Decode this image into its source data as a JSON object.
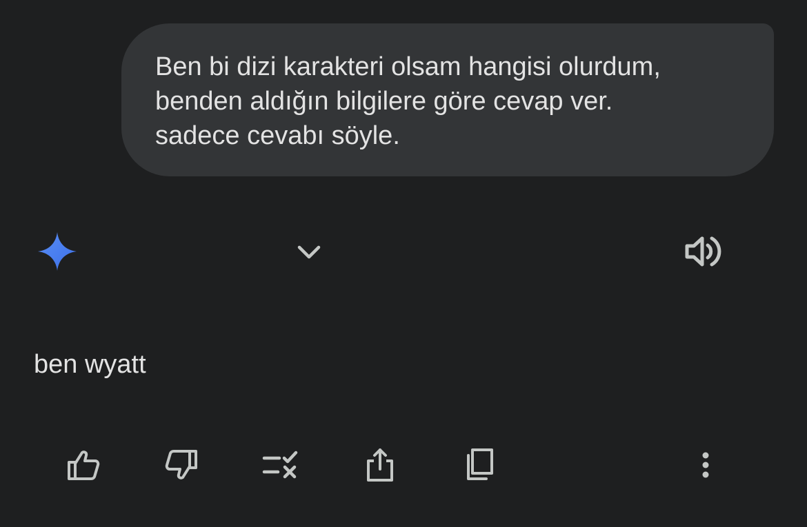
{
  "conversation": {
    "user_message": {
      "lines": [
        "Ben bi dizi karakteri olsam hangisi olurdum,",
        "benden aldığın bilgilere göre cevap ver.",
        "sadece cevabı söyle."
      ]
    },
    "response": {
      "header": {
        "logo_icon": "gemini-sparkle-icon",
        "toggle_icon": "chevron-down-icon",
        "read_aloud_icon": "speaker-icon"
      },
      "text": "ben wyatt"
    },
    "actions": [
      {
        "name": "thumbs-up-icon"
      },
      {
        "name": "thumbs-down-icon"
      },
      {
        "name": "modify-response-icon"
      },
      {
        "name": "share-icon"
      },
      {
        "name": "copy-icon"
      },
      {
        "name": "more-options-icon"
      }
    ]
  },
  "colors": {
    "background": "#1e1f20",
    "bubble": "#333537",
    "text": "#e3e3e3",
    "icon": "#c4c7c5",
    "accent_blue": "#4a8cff"
  }
}
